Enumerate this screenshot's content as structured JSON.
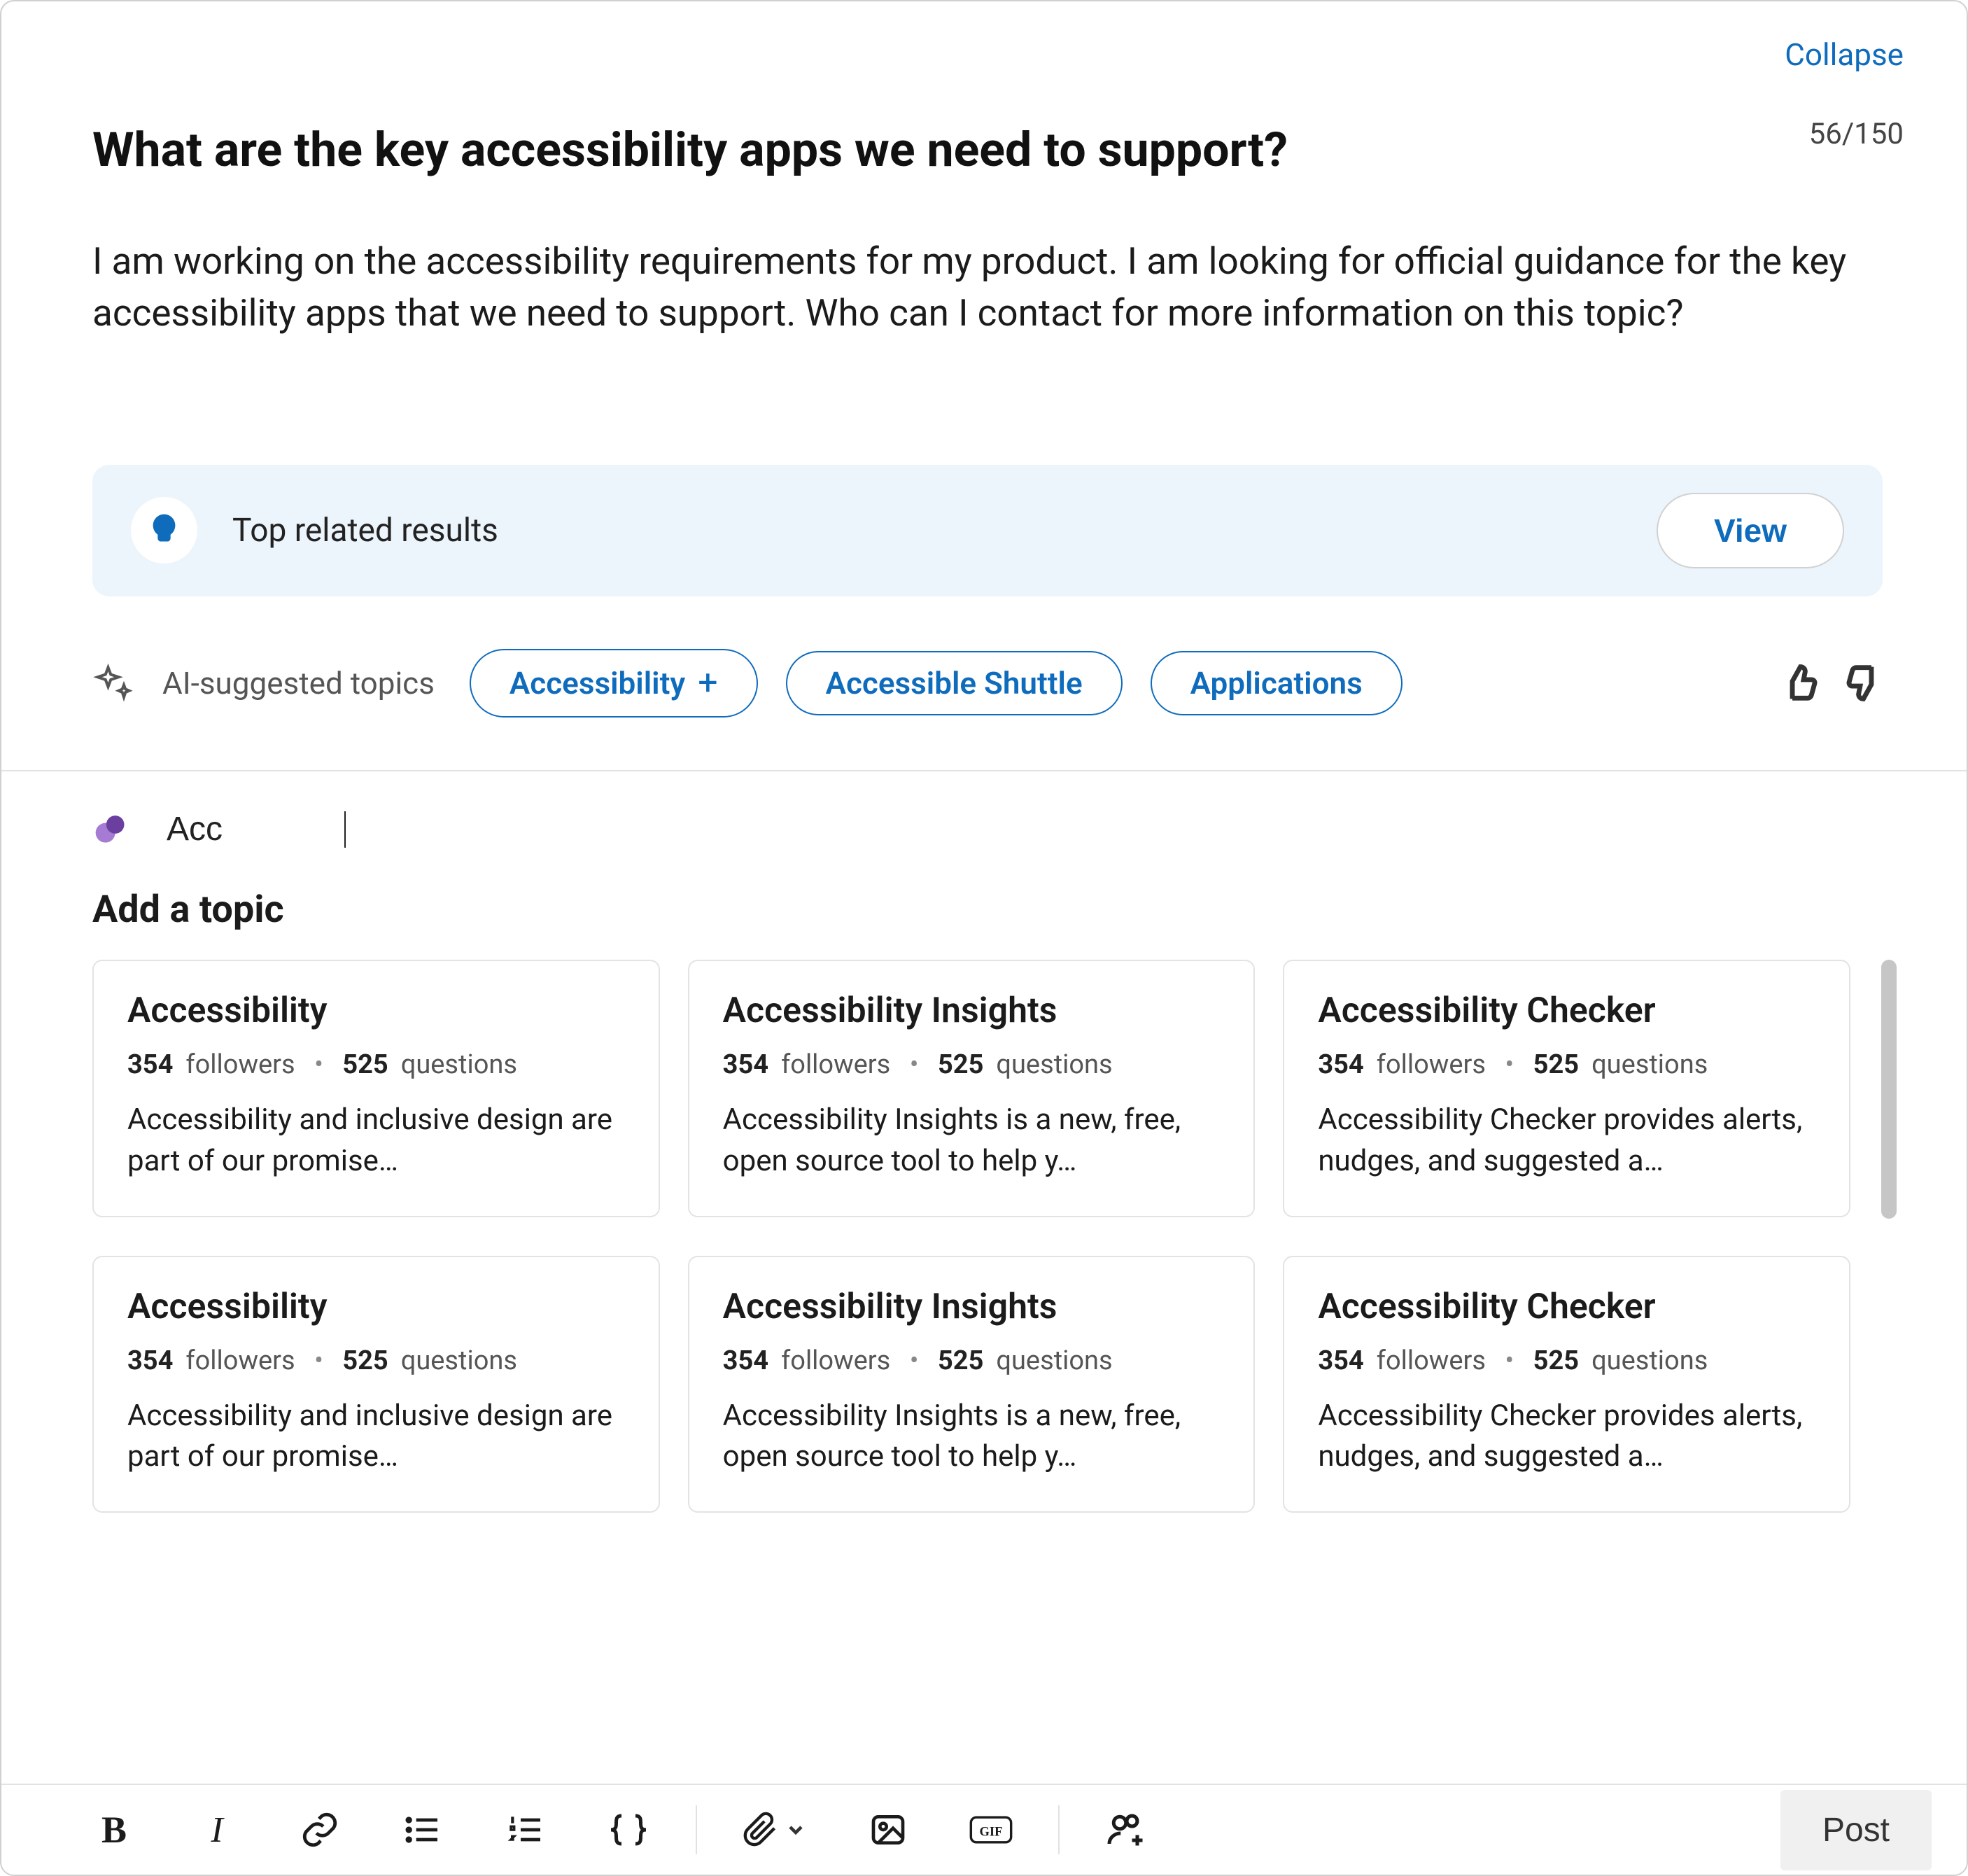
{
  "header": {
    "collapse_label": "Collapse",
    "counter": "56/150"
  },
  "question": {
    "title": "What are the key accessibility apps we need to support?",
    "body": "I am working on the accessibility requirements for my product. I am looking for official guidance for the key accessibility apps that we need to support. Who can I contact for more information on this topic?"
  },
  "related": {
    "label": "Top related results",
    "view_label": "View"
  },
  "ai_topics": {
    "label": "AI-suggested topics",
    "chips": [
      {
        "label": "Accessibility",
        "has_plus": true
      },
      {
        "label": "Accessible Shuttle",
        "has_plus": false
      },
      {
        "label": "Applications",
        "has_plus": false
      }
    ]
  },
  "topic_input": {
    "value": "Acc"
  },
  "add_topic": {
    "heading": "Add a topic",
    "cards": [
      {
        "title": "Accessibility",
        "followers": "354",
        "questions": "525",
        "desc": "Accessibility and inclusive design are part of our promise…"
      },
      {
        "title": "Accessibility Insights",
        "followers": "354",
        "questions": "525",
        "desc": "Accessibility Insights is a new, free, open source tool to help y…"
      },
      {
        "title": "Accessibility Checker",
        "followers": "354",
        "questions": "525",
        "desc": "Accessibility Checker provides alerts, nudges, and suggested a…"
      },
      {
        "title": "Accessibility",
        "followers": "354",
        "questions": "525",
        "desc": "Accessibility and inclusive design are part of our promise…"
      },
      {
        "title": "Accessibility Insights",
        "followers": "354",
        "questions": "525",
        "desc": "Accessibility Insights is a new, free, open source tool to help y…"
      },
      {
        "title": "Accessibility Checker",
        "followers": "354",
        "questions": "525",
        "desc": "Accessibility Checker provides alerts, nudges, and suggested a…"
      }
    ],
    "followers_word": "followers",
    "questions_word": "questions"
  },
  "toolbar": {
    "post_label": "Post"
  }
}
